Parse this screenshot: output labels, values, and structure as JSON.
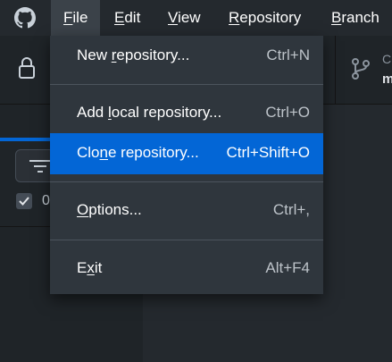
{
  "menubar": {
    "items": [
      {
        "label": "File",
        "underline_char": "F"
      },
      {
        "label": "Edit",
        "underline_char": "E"
      },
      {
        "label": "View",
        "underline_char": "V"
      },
      {
        "label": "Repository",
        "underline_char": "R"
      },
      {
        "label": "Branch",
        "underline_char": "B"
      }
    ],
    "active_index": 0
  },
  "toolbar": {
    "branch_top": "C",
    "branch_bottom": "m"
  },
  "left_panel": {
    "count_prefix": "0"
  },
  "file_menu": {
    "items": [
      {
        "label_pre": "New ",
        "label_u": "r",
        "label_post": "epository...",
        "shortcut": "Ctrl+N",
        "highlighted": false
      },
      {
        "label_pre": "Add ",
        "label_u": "l",
        "label_post": "ocal repository...",
        "shortcut": "Ctrl+O",
        "highlighted": false
      },
      {
        "label_pre": "Clo",
        "label_u": "n",
        "label_post": "e repository...",
        "shortcut": "Ctrl+Shift+O",
        "highlighted": true
      },
      {
        "label_pre": "",
        "label_u": "O",
        "label_post": "ptions...",
        "shortcut": "Ctrl+,",
        "highlighted": false
      },
      {
        "label_pre": "E",
        "label_u": "x",
        "label_post": "it",
        "shortcut": "Alt+F4",
        "highlighted": false
      }
    ]
  },
  "colors": {
    "titlebar_bg": "#24292e",
    "menu_bg": "#2f363d",
    "highlight": "#0366d6",
    "active_menu": "#3b4249"
  },
  "icons": [
    "github-logo-icon",
    "lock-icon",
    "branch-icon",
    "filter-icon",
    "checkmark-icon"
  ]
}
